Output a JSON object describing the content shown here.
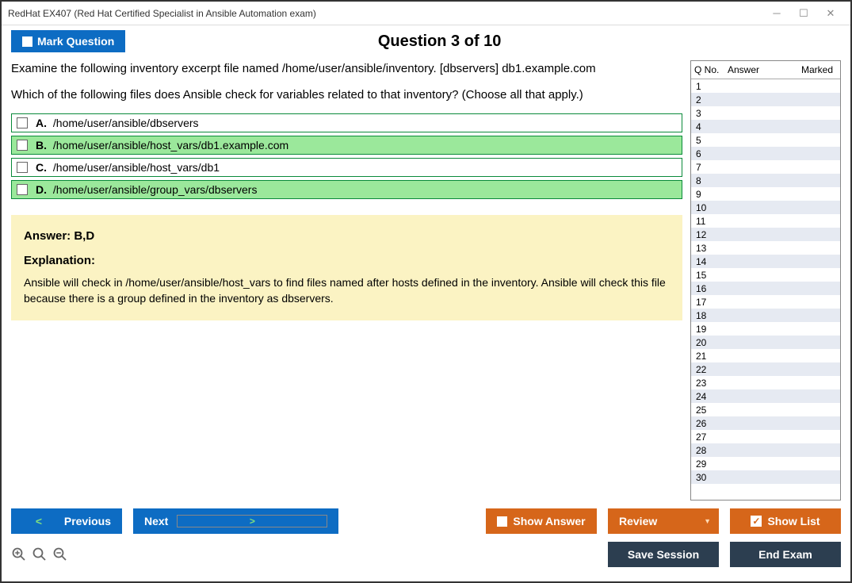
{
  "window": {
    "title": "RedHat EX407 (Red Hat Certified Specialist in Ansible Automation exam)"
  },
  "header": {
    "mark_label": "Mark Question",
    "question_title": "Question 3 of 10"
  },
  "question": {
    "line1": "Examine the following inventory excerpt file named /home/user/ansible/inventory. [dbservers] db1.example.com",
    "line2": "Which of the following files does Ansible check for variables related to that inventory? (Choose all that apply.)",
    "options": [
      {
        "letter": "A.",
        "text": "/home/user/ansible/dbservers",
        "correct": false
      },
      {
        "letter": "B.",
        "text": "/home/user/ansible/host_vars/db1.example.com",
        "correct": true
      },
      {
        "letter": "C.",
        "text": "/home/user/ansible/host_vars/db1",
        "correct": false
      },
      {
        "letter": "D.",
        "text": "/home/user/ansible/group_vars/dbservers",
        "correct": true
      }
    ]
  },
  "answer": {
    "head": "Answer: B,D",
    "exp_head": "Explanation:",
    "exp_text": "Ansible will check in /home/user/ansible/host_vars to find files named after hosts defined in the inventory. Ansible will check this file because there is a group defined in the inventory as dbservers."
  },
  "sidebar": {
    "h_no": "Q No.",
    "h_ans": "Answer",
    "h_mk": "Marked",
    "count": 30
  },
  "footer": {
    "previous": "Previous",
    "next": "Next",
    "show_answer": "Show Answer",
    "review": "Review",
    "show_list": "Show List",
    "save_session": "Save Session",
    "end_exam": "End Exam"
  }
}
